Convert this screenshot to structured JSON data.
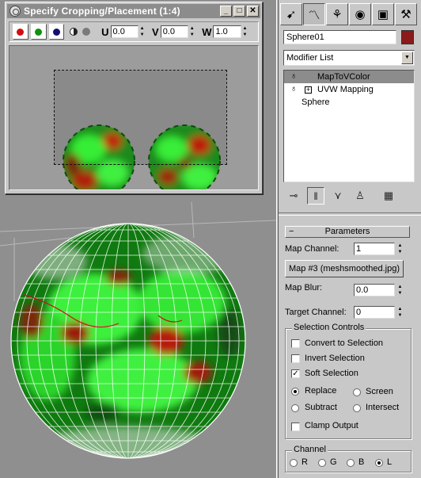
{
  "dialog": {
    "title": "Specify Cropping/Placement (1:4)",
    "controls": {
      "minimize": "_",
      "maximize": "□",
      "close": "✕"
    },
    "toolbar": {
      "u_label": "U",
      "u_value": "0.0",
      "v_label": "V",
      "v_value": "0.0",
      "w_label": "W",
      "w_value": "1.0"
    }
  },
  "panel": {
    "object_name": "Sphere01",
    "object_color": "#8b1a1a",
    "modifier_list": "Modifier List",
    "stack": [
      {
        "label": "MapToVColor",
        "selected": true
      },
      {
        "label": "UVW Mapping",
        "selected": false
      },
      {
        "label": "Sphere",
        "selected": false
      }
    ],
    "rollout_title": "Parameters",
    "map_channel_label": "Map Channel:",
    "map_channel_value": "1",
    "map_button": "Map #3 (meshsmoothed.jpg)",
    "map_blur_label": "Map Blur:",
    "map_blur_value": "0.0",
    "target_channel_label": "Target Channel:",
    "target_channel_value": "0",
    "selection_controls_title": "Selection Controls",
    "convert_to_selection": "Convert to Selection",
    "invert_selection": "Invert Selection",
    "soft_selection": "Soft Selection",
    "replace": "Replace",
    "screen": "Screen",
    "subtract": "Subtract",
    "intersect": "Intersect",
    "clamp_output": "Clamp Output",
    "channel_title": "Channel",
    "channels": [
      "R",
      "G",
      "B",
      "L"
    ]
  },
  "colors": {
    "accent_red": "#cc1111",
    "texture_green": "#22dd22",
    "panel_bg": "#c8c8c8"
  }
}
